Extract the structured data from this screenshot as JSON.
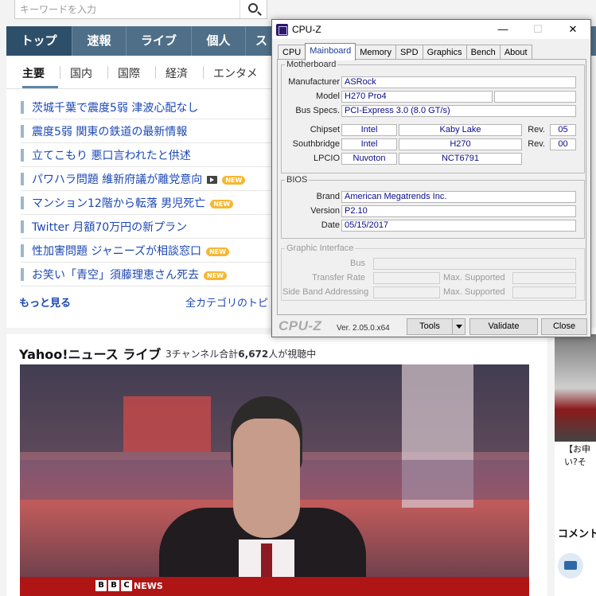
{
  "yahoo": {
    "search": {
      "placeholder": "キーワードを入力"
    },
    "nav": [
      {
        "label": "トップ",
        "w": 83
      },
      {
        "label": "速報",
        "w": 68
      },
      {
        "label": "ライブ",
        "w": 82
      },
      {
        "label": "個人",
        "w": 68
      },
      {
        "label": "ス",
        "w": 40
      }
    ],
    "subtabs": [
      "主要",
      "国内",
      "国際",
      "経済",
      "エンタメ"
    ],
    "headlines": [
      {
        "text": "茨城千葉で震度5弱 津波心配なし",
        "badge": "",
        "video": false
      },
      {
        "text": "震度5弱 関東の鉄道の最新情報",
        "badge": "",
        "video": false
      },
      {
        "text": "立てこもり 悪口言われたと供述",
        "badge": "",
        "video": false
      },
      {
        "text": "パワハラ問題 維新府議が離党意向",
        "badge": "NEW",
        "video": true
      },
      {
        "text": "マンション12階から転落 男児死亡",
        "badge": "NEW",
        "video": false
      },
      {
        "text": "Twitter 月額70万円の新プラン",
        "badge": "",
        "video": false
      },
      {
        "text": "性加害問題 ジャニーズが相談窓口",
        "badge": "NEW",
        "video": false
      },
      {
        "text": "お笑い「青空」須藤理恵さん死去",
        "badge": "NEW",
        "video": false
      }
    ],
    "more_link": "もっと見る",
    "all_topics": "全カテゴリのトピ",
    "live": {
      "title": "Yahoo!ニュース ライブ",
      "viewers_pre": "3チャンネル合計",
      "viewers_count": "6,672",
      "viewers_post": "人が視聴中",
      "channel": "NEWS"
    },
    "right": {
      "promo_line1": "【お申",
      "promo_line2": "い?そ",
      "comments": "コメント"
    }
  },
  "cpuz": {
    "title": "CPU-Z",
    "tabs": [
      "CPU",
      "Mainboard",
      "Memory",
      "SPD",
      "Graphics",
      "Bench",
      "About"
    ],
    "active_tab": "Mainboard",
    "motherboard": {
      "legend": "Motherboard",
      "manufacturer_label": "Manufacturer",
      "manufacturer": "ASRock",
      "model_label": "Model",
      "model": "H270 Pro4",
      "model_rev": "",
      "bus_label": "Bus Specs.",
      "bus": "PCI-Express 3.0 (8.0 GT/s)",
      "chipset_label": "Chipset",
      "chipset_vendor": "Intel",
      "chipset_name": "Kaby Lake",
      "chipset_rev_label": "Rev.",
      "chipset_rev": "05",
      "south_label": "Southbridge",
      "south_vendor": "Intel",
      "south_name": "H270",
      "south_rev_label": "Rev.",
      "south_rev": "00",
      "lpcio_label": "LPCIO",
      "lpcio_vendor": "Nuvoton",
      "lpcio_name": "NCT6791"
    },
    "bios": {
      "legend": "BIOS",
      "brand_label": "Brand",
      "brand": "American Megatrends Inc.",
      "version_label": "Version",
      "version": "P2.10",
      "date_label": "Date",
      "date": "05/15/2017"
    },
    "graphic": {
      "legend": "Graphic Interface",
      "bus_label": "Bus",
      "transfer_label": "Transfer Rate",
      "maxsup_label": "Max. Supported",
      "sideband_label": "Side Band Addressing"
    },
    "footer": {
      "logo": "CPU-Z",
      "version": "Ver. 2.05.0.x64",
      "tools": "Tools",
      "validate": "Validate",
      "close": "Close"
    },
    "window_buttons": {
      "minimize": "—",
      "maximize": "☐",
      "close": "✕"
    }
  }
}
